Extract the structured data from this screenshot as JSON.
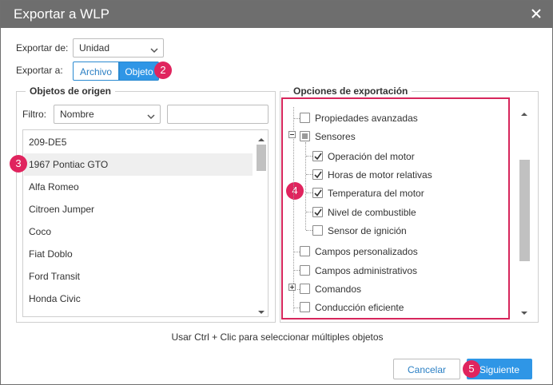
{
  "dialog": {
    "title": "Exportar a WLP",
    "close_icon": "close-icon"
  },
  "export_from": {
    "label": "Exportar de:",
    "value": "Unidad"
  },
  "export_to": {
    "label": "Exportar a:",
    "options": [
      "Archivo",
      "Objeto"
    ],
    "selected": "Objeto"
  },
  "source": {
    "legend": "Objetos de origen",
    "filter_label": "Filtro:",
    "filter_value": "Nombre",
    "search_value": "",
    "items": [
      "209-DE5",
      "1967 Pontiac GTO",
      "Alfa Romeo",
      "Citroen Jumper",
      "Coco",
      "Fiat Doblo",
      "Ford Transit",
      "Honda Civic"
    ],
    "selected_item": "1967 Pontiac GTO"
  },
  "options": {
    "legend": "Opciones de exportación",
    "tree": [
      {
        "label": "Propiedades avanzadas",
        "checked": false
      },
      {
        "label": "Sensores",
        "state": "partial",
        "expanded": true
      },
      {
        "label": "Operación del motor",
        "checked": true
      },
      {
        "label": "Horas de motor relativas",
        "checked": true
      },
      {
        "label": "Temperatura del motor",
        "checked": true
      },
      {
        "label": "Nivel de combustible",
        "checked": true
      },
      {
        "label": "Sensor de ignición",
        "checked": false
      },
      {
        "label": "Campos personalizados",
        "checked": false
      },
      {
        "label": "Campos administrativos",
        "checked": false
      },
      {
        "label": "Comandos",
        "checked": false,
        "expanded": false
      },
      {
        "label": "Conducción eficiente",
        "checked": false
      }
    ]
  },
  "hint": "Usar Ctrl + Clic para seleccionar múltiples objetos",
  "buttons": {
    "cancel": "Cancelar",
    "next": "Siguiente"
  },
  "badges": [
    "2",
    "3",
    "4",
    "5"
  ],
  "colors": {
    "accent": "#2f96e6",
    "highlight": "#d7265c",
    "titlebar": "#6e6e6e"
  }
}
